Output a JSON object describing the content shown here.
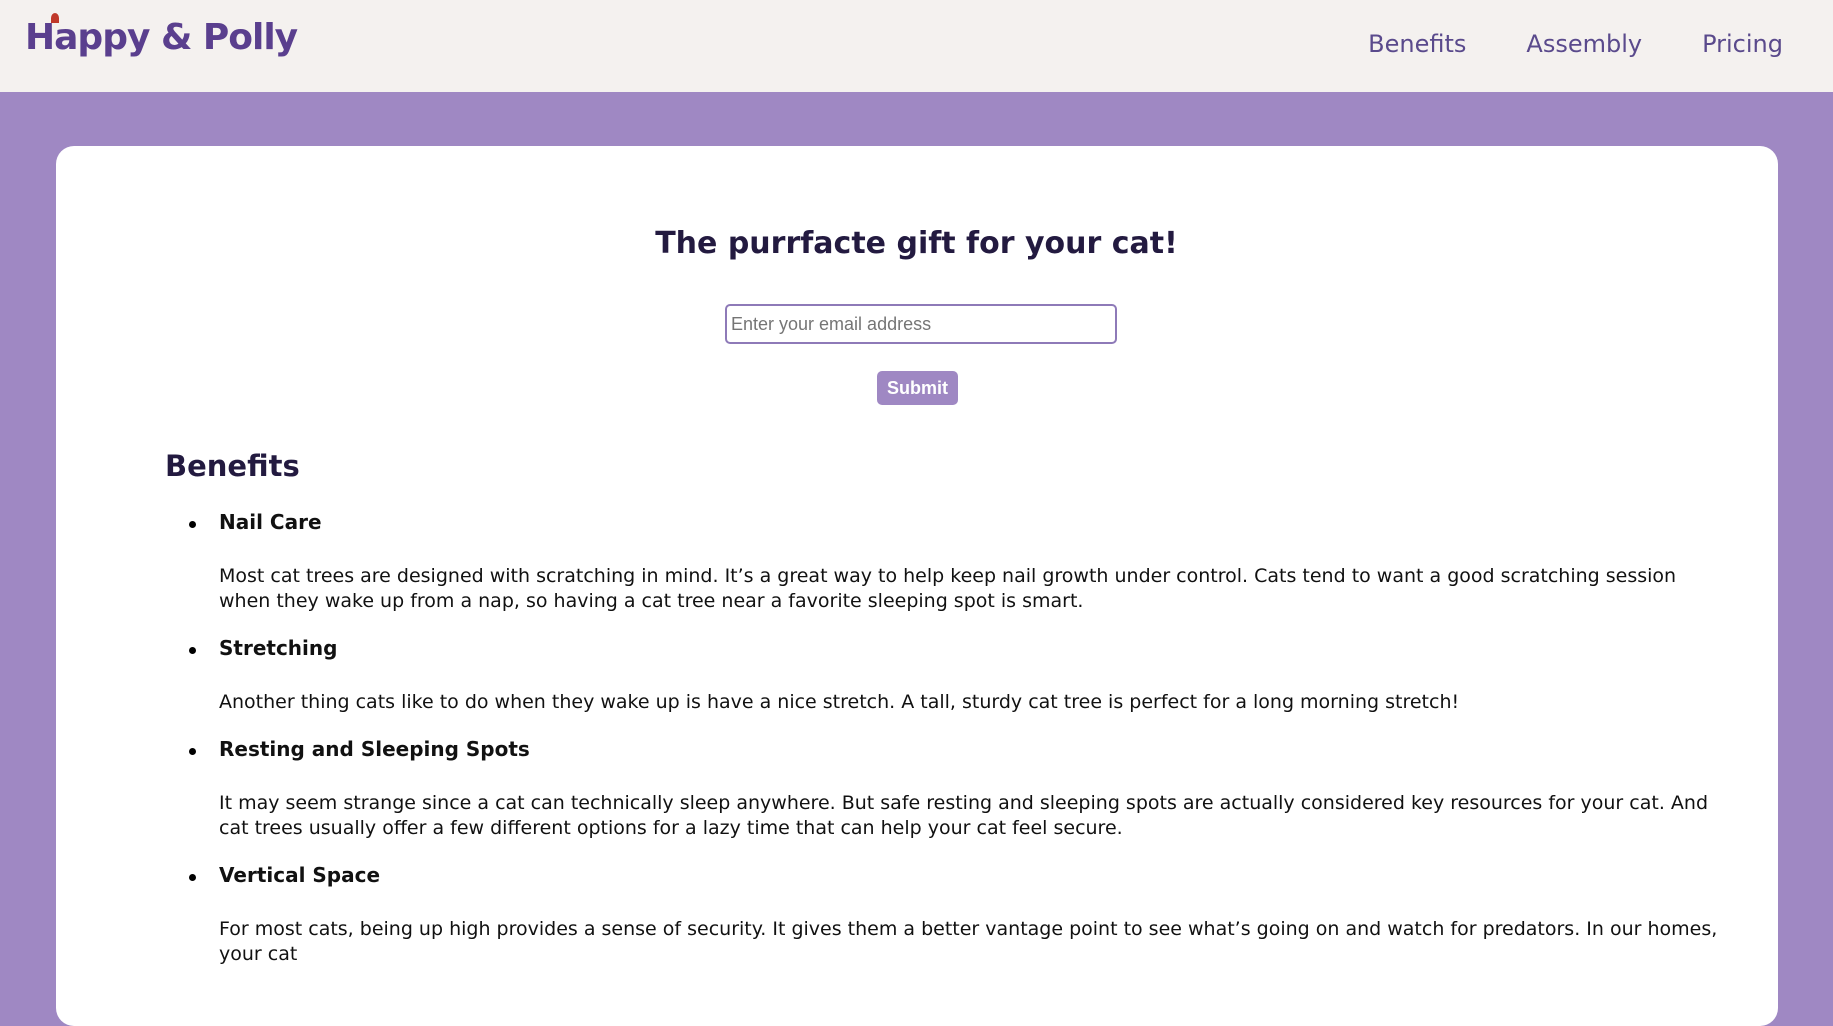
{
  "brand": {
    "name": "Happy & Polly"
  },
  "nav": {
    "items": [
      "Benefits",
      "Assembly",
      "Pricing"
    ]
  },
  "hero": {
    "title": "The purrfacte gift for your cat!",
    "email_placeholder": "Enter your email address",
    "submit_label": "Submit"
  },
  "benefits": {
    "heading": "Benefits",
    "items": [
      {
        "title": "Nail Care",
        "text": "Most cat trees are designed with scratching in mind. It’s a great way to help keep nail growth under control. Cats tend to want a good scratching session when they wake up from a nap, so having a cat tree near a favorite sleeping spot is smart."
      },
      {
        "title": "Stretching",
        "text": "Another thing cats like to do when they wake up is have a nice stretch. A tall, sturdy cat tree is perfect for a long morning stretch!"
      },
      {
        "title": "Resting and Sleeping Spots",
        "text": "It may seem strange since a cat can technically sleep anywhere. But safe resting and sleeping spots are actually considered key resources for your cat. And cat trees usually offer a few different options for a lazy time that can help your cat feel secure."
      },
      {
        "title": "Vertical Space",
        "text": "For most cats, being up high provides a sense of security. It gives them a better vantage point to see what’s going on and watch for predators. In our homes, your cat"
      }
    ]
  },
  "colors": {
    "background": "#9f88c3",
    "topbar": "#f4f1ef",
    "brand": "#5a3f8e",
    "heading": "#231a40"
  }
}
